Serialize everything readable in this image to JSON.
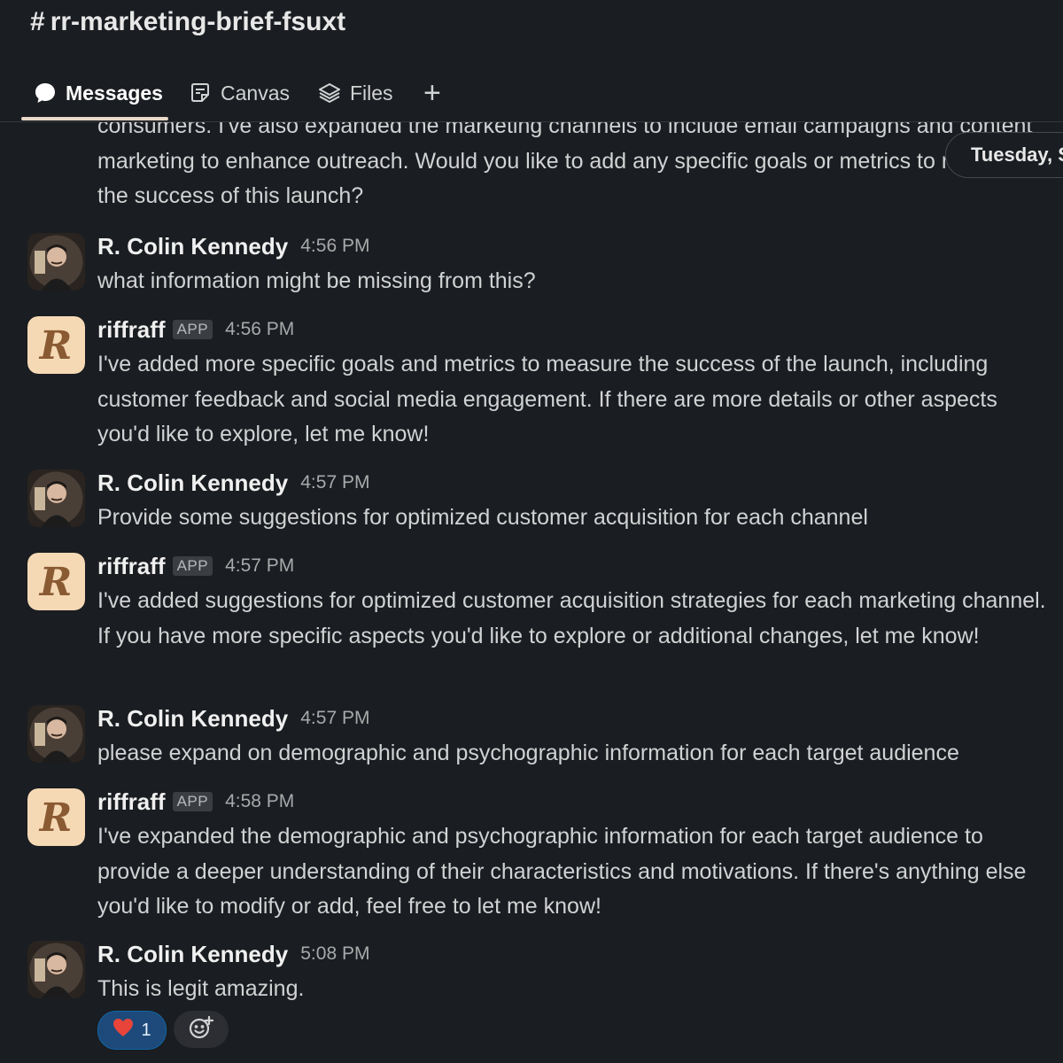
{
  "channel": {
    "hash": "#",
    "name": "rr-marketing-brief-fsuxt"
  },
  "tabs": [
    {
      "label": "Messages",
      "icon": "message-bubble-icon",
      "active": true
    },
    {
      "label": "Canvas",
      "icon": "canvas-icon",
      "active": false
    },
    {
      "label": "Files",
      "icon": "layers-icon",
      "active": false
    }
  ],
  "add_tab": "+",
  "date_divider": "Tuesday, S",
  "partial_message": "consumers. I've also expanded the marketing channels to include email campaigns and content marketing to enhance outreach. Would you like to add any specific goals or metrics to measure the success of this launch?",
  "messages": [
    {
      "author": "R. Colin Kennedy",
      "time": "4:56 PM",
      "text": "what information might be missing from this?"
    },
    {
      "author": "riffraff",
      "badge": "APP",
      "time": "4:56 PM",
      "text": "I've added more specific goals and metrics to measure the success of the launch, including customer feedback and social media engagement. If there are more details or other aspects you'd like to explore, let me know!"
    },
    {
      "author": "R. Colin Kennedy",
      "time": "4:57 PM",
      "text": "Provide some suggestions for optimized customer acquisition for each channel"
    },
    {
      "author": "riffraff",
      "badge": "APP",
      "time": "4:57 PM",
      "text": "I've added suggestions for optimized customer acquisition strategies for each marketing channel. If you have more specific aspects you'd like to explore or additional changes, let me know!"
    },
    {
      "author": "R. Colin Kennedy",
      "time": "4:57 PM",
      "text": "please expand on demographic and psychographic information for each target audience"
    },
    {
      "author": "riffraff",
      "badge": "APP",
      "time": "4:58 PM",
      "text": "I've expanded the demographic and psychographic information for each target audience to provide a deeper understanding of their characteristics and motivations. If there's anything else you'd like to modify or add, feel free to let me know!"
    },
    {
      "author": "R. Colin Kennedy",
      "time": "5:08 PM",
      "text": "This is legit amazing."
    }
  ],
  "reactions": [
    {
      "emoji": "❤️",
      "count": "1"
    }
  ],
  "add_reaction_icon": "add-emoji-icon",
  "colors": {
    "background": "#1a1d21",
    "text": "#d1d2d3",
    "tab_underline": "#e8d9c8",
    "reaction_active": "#1d4a7a",
    "riffraff_avatar": "#f5d9b5"
  }
}
